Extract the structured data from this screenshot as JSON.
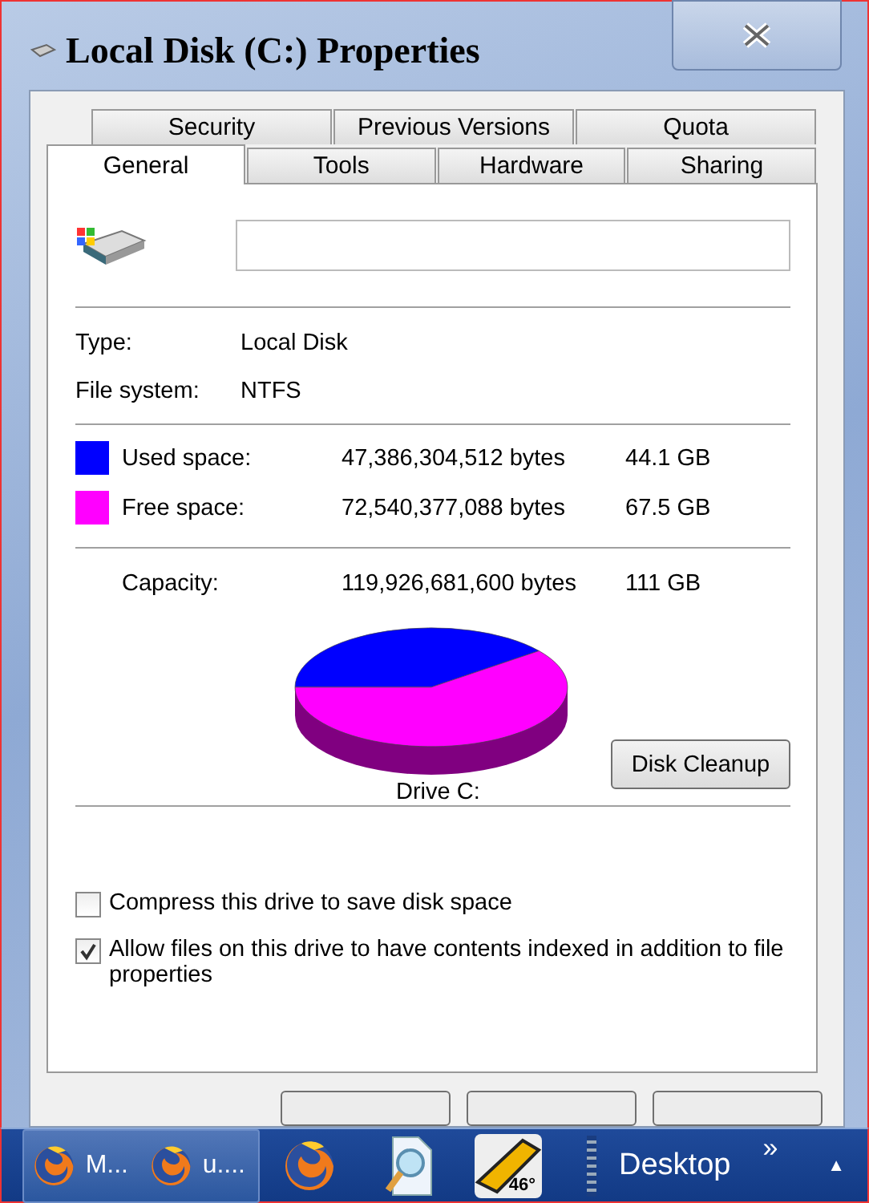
{
  "window": {
    "title": "Local Disk (C:) Properties"
  },
  "tabs": [
    [
      {
        "label": "Security",
        "selected": false
      },
      {
        "label": "Previous Versions",
        "selected": false
      },
      {
        "label": "Quota",
        "selected": false
      }
    ],
    [
      {
        "label": "General",
        "selected": true
      },
      {
        "label": "Tools",
        "selected": false
      },
      {
        "label": "Hardware",
        "selected": false
      },
      {
        "label": "Sharing",
        "selected": false
      }
    ]
  ],
  "info": [
    {
      "label": "Type:",
      "value": "Local Disk"
    },
    {
      "label": "File system:",
      "value": "NTFS"
    }
  ],
  "space": [
    {
      "label": "Used space:",
      "bytes": "47,386,304,512 bytes",
      "size": "44.1 GB",
      "color": "#0000ff"
    },
    {
      "label": "Free space:",
      "bytes": "72,540,377,088 bytes",
      "size": "67.5 GB",
      "color": "#ff00ff"
    }
  ],
  "capacity": {
    "label": "Capacity:",
    "bytes": "119,926,681,600 bytes",
    "size": "111 GB"
  },
  "chart_label": "Drive C:",
  "cleanup_button": "Disk Cleanup",
  "options": [
    {
      "label": "Compress this drive to save disk space",
      "checked": false
    },
    {
      "label": "Allow files on this drive to have contents indexed in addition to file properties",
      "checked": true
    }
  ],
  "taskbar": {
    "items": [
      {
        "kind": "firefox",
        "label": "M..."
      },
      {
        "kind": "firefox",
        "label": "u...."
      },
      {
        "kind": "firefox"
      },
      {
        "kind": "document"
      },
      {
        "kind": "gauge",
        "label": "46°"
      }
    ],
    "toolbar": "Desktop",
    "more": "»",
    "tray": "▲"
  }
}
